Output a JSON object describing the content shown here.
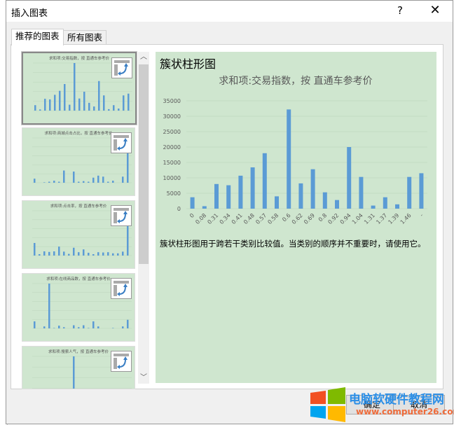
{
  "window": {
    "title": "插入图表",
    "help": "?",
    "close": "✕"
  },
  "tabs": [
    {
      "label": "推荐的图表",
      "active": true
    },
    {
      "label": "所有图表",
      "active": false
    }
  ],
  "thumbnails": [
    {
      "title": "求和项:交易指数，按 直通车参考价",
      "values": [
        3700,
        800,
        8000,
        7600,
        10700,
        13400,
        18000,
        4000,
        32200,
        8200,
        12800,
        5300,
        2800,
        20000,
        10300,
        1000,
        3700,
        1400,
        10300,
        11500
      ],
      "selected": true
    },
    {
      "title": "求和项:商城点击占比，按 直通车参考价",
      "values": [
        0.2,
        0,
        0.02,
        0.05,
        0.1,
        0.05,
        0.6,
        0,
        0.55,
        0.05,
        0.08,
        0.05,
        0.25,
        0.35,
        0.3,
        0.05,
        0.1,
        0,
        0.3,
        2.2
      ],
      "selected": false
    },
    {
      "title": "求和项:点击率，按 直通车参考价",
      "values": [
        4.5,
        0.5,
        1.5,
        1.3,
        1.5,
        3.2,
        1.4,
        0.6,
        2.8,
        1.2,
        2.2,
        1.0,
        0.5,
        1.2,
        1.1,
        1.2,
        0.8,
        0.8,
        1.4,
        16
      ],
      "selected": false
    },
    {
      "title": "求和项:在线商品数，按 直通车参考价",
      "values": [
        1800,
        0,
        500,
        11500,
        100,
        700,
        300,
        0,
        800,
        300,
        800,
        100,
        1800,
        500,
        0,
        0,
        100,
        0,
        500,
        2200
      ],
      "selected": false
    },
    {
      "title": "求和项:搜索人气，按 直通车参考价",
      "values": [
        0,
        0,
        0,
        0,
        0,
        0,
        0,
        0,
        33000,
        0,
        0,
        0,
        0,
        0,
        0,
        0,
        0,
        0,
        0,
        0
      ],
      "selected": false
    }
  ],
  "preview": {
    "heading": "簇状柱形图",
    "description": "簇状柱形图用于跨若干类别比较值。当类别的顺序并不重要时，请使用它。"
  },
  "chart_data": {
    "type": "bar",
    "title": "求和项:交易指数，按 直通车参考价",
    "categories": [
      "0",
      "0.08",
      "0.31",
      "0.34",
      "0.41",
      "0.48",
      "0.57",
      "0.58",
      "0.6",
      "0.62",
      "0.69",
      "0.8",
      "0.92",
      "0.94",
      "1.04",
      "1.31",
      "1.37",
      "1.39",
      "1.46",
      "-"
    ],
    "values": [
      3700,
      800,
      8000,
      7600,
      10700,
      13400,
      18000,
      4000,
      32200,
      8200,
      12800,
      5300,
      2800,
      20000,
      10300,
      1000,
      3700,
      1400,
      10300,
      11500
    ],
    "yticks": [
      "0",
      "5000",
      "10000",
      "15000",
      "20000",
      "25000",
      "30000",
      "35000"
    ],
    "ylim": [
      0,
      35000
    ],
    "grid": true,
    "bar_color": "#5b9bd5"
  },
  "buttons": {
    "ok": "确定",
    "cancel": "取消"
  },
  "watermark": {
    "text": "电脑软硬件教程网",
    "url": "www.computer26.com"
  }
}
